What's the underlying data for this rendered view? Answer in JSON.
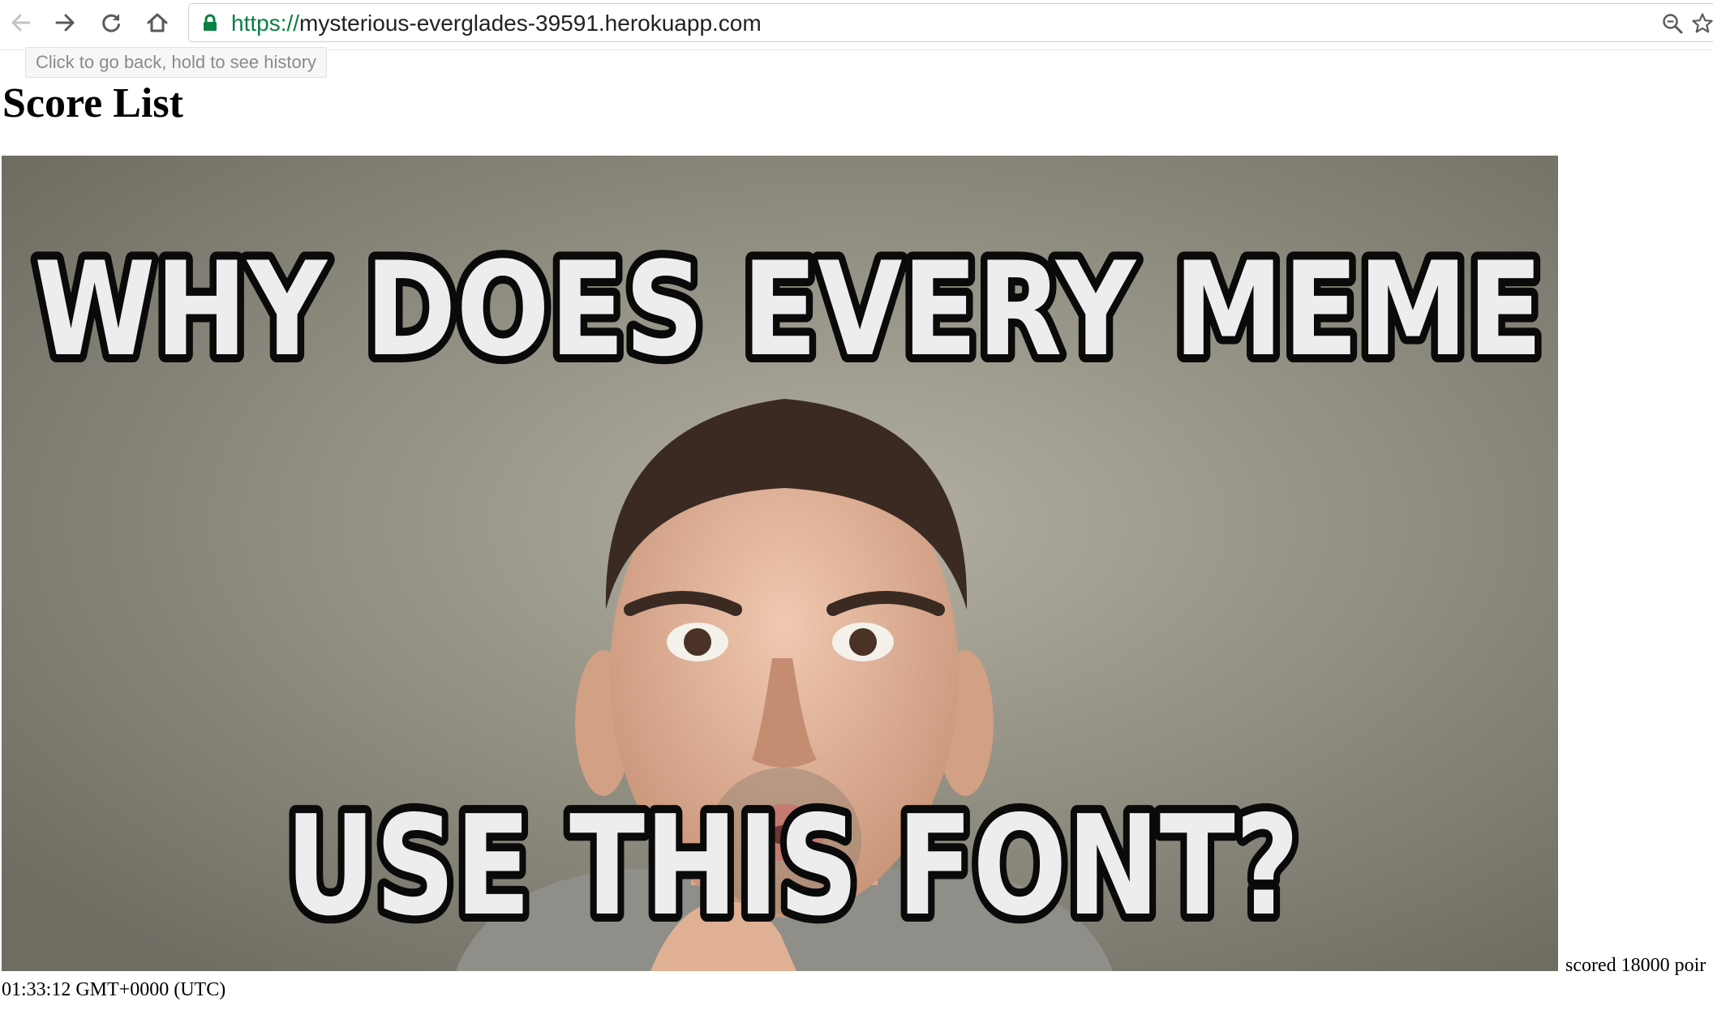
{
  "browser": {
    "url_scheme": "https://",
    "url_host": "mysterious-everglades-39591.herokuapp.com",
    "back_tooltip": "Click to go back, hold to see history",
    "icons": [
      "back-arrow-icon",
      "forward-arrow-icon",
      "reload-icon",
      "home-icon",
      "lock-icon",
      "zoom-icon",
      "bookmark-star-icon"
    ],
    "secure_color": "#0b8043"
  },
  "page": {
    "title": "Score List",
    "meme": {
      "top_text": "WHY DOES EVERY MEME",
      "bottom_text": "USE THIS FONT?"
    },
    "entry_score_text": "scored 18000 poir",
    "entry_time_text": "01:33:12 GMT+0000 (UTC)"
  }
}
